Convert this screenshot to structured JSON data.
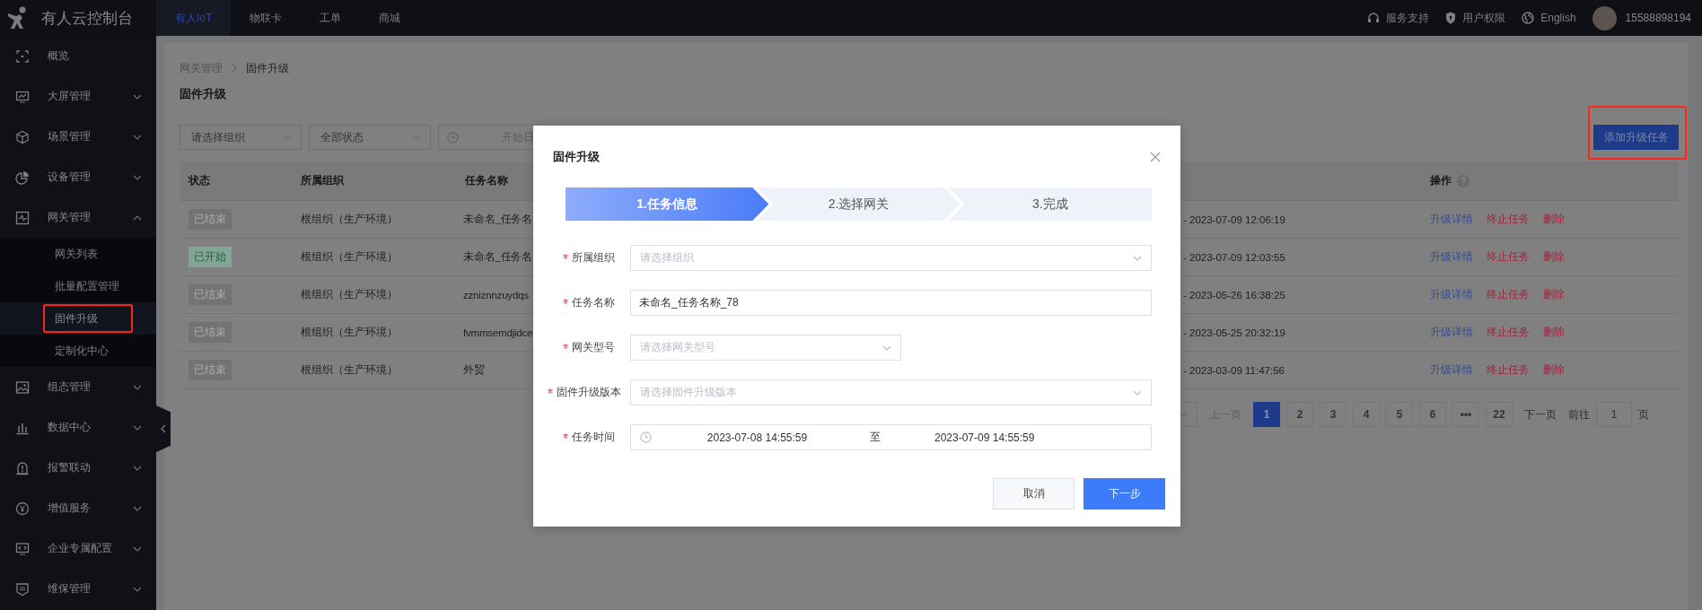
{
  "app": {
    "title": "有人云控制台"
  },
  "top_nav": [
    {
      "label": "有人IoT",
      "selected": true
    },
    {
      "label": "物联卡",
      "selected": false
    },
    {
      "label": "工单",
      "selected": false
    },
    {
      "label": "商城",
      "selected": false
    }
  ],
  "header_links": [
    {
      "kind": "support",
      "label": "服务支持"
    },
    {
      "kind": "permissions",
      "label": "用户权限"
    },
    {
      "kind": "language",
      "label": "English"
    }
  ],
  "user": {
    "phone": "15588898194"
  },
  "sidebar": {
    "items": [
      {
        "kind": "overview",
        "label": "概览"
      },
      {
        "kind": "screen",
        "label": "大屏管理",
        "expanded": false
      },
      {
        "kind": "cube",
        "label": "场景管理",
        "expanded": false
      },
      {
        "kind": "pie",
        "label": "设备管理",
        "expanded": false
      },
      {
        "kind": "pulse",
        "label": "网关管理",
        "expanded": true,
        "children": [
          {
            "label": "网关列表",
            "selected": false,
            "annotated": false
          },
          {
            "label": "批量配置管理",
            "selected": false,
            "annotated": false
          },
          {
            "label": "固件升级",
            "selected": true,
            "annotated": true
          },
          {
            "label": "定制化中心",
            "selected": false,
            "annotated": false
          }
        ]
      },
      {
        "kind": "image",
        "label": "组态管理",
        "expanded": false
      },
      {
        "kind": "bars",
        "label": "数据中心",
        "expanded": false
      },
      {
        "kind": "alarm",
        "label": "报警联动",
        "expanded": false
      },
      {
        "kind": "coin",
        "label": "增值服务",
        "expanded": false
      },
      {
        "kind": "code",
        "label": "企业专属配置",
        "expanded": false
      },
      {
        "kind": "doc",
        "label": "维保管理",
        "expanded": false
      }
    ]
  },
  "breadcrumb": [
    "网关管理",
    "固件升级"
  ],
  "page_title": "固件升级",
  "filters": [
    {
      "kind": "select",
      "placeholder": "请选择组织"
    },
    {
      "kind": "select",
      "value": "全部状态"
    },
    {
      "kind": "date",
      "placeholder": "开始日"
    }
  ],
  "add_button": {
    "label": "添加升级任务",
    "annotated": true
  },
  "table": {
    "columns": [
      {
        "label": "状态",
        "help": false
      },
      {
        "label": "所属组织",
        "help": false
      },
      {
        "label": "任务名称",
        "help": false
      },
      {
        "label": "操作",
        "help": true
      }
    ],
    "rows": [
      {
        "status": {
          "kind": "ended",
          "label": "已结束"
        },
        "organization": "根组织（生产环境）",
        "task_name": "未命名_任务名",
        "column_4": "- 2023-07-09 12:06:19",
        "actions": [
          {
            "kind": "details",
            "label": "升级详情"
          },
          {
            "kind": "stop",
            "label": "终止任务"
          },
          {
            "kind": "delete",
            "label": "删除"
          }
        ]
      },
      {
        "status": {
          "kind": "started",
          "label": "已开始"
        },
        "organization": "根组织（生产环境）",
        "task_name": "未命名_任务名",
        "column_4": "- 2023-07-09 12:03:55",
        "actions": [
          {
            "kind": "details",
            "label": "升级详情"
          },
          {
            "kind": "stop",
            "label": "终止任务"
          },
          {
            "kind": "delete",
            "label": "删除"
          }
        ]
      },
      {
        "status": {
          "kind": "ended",
          "label": "已结束"
        },
        "organization": "根组织（生产环境）",
        "task_name": "zzniznnzuydqs",
        "column_4": "- 2023-05-26 16:38:25",
        "actions": [
          {
            "kind": "details",
            "label": "升级详情"
          },
          {
            "kind": "stop",
            "label": "终止任务"
          },
          {
            "kind": "delete",
            "label": "删除"
          }
        ]
      },
      {
        "status": {
          "kind": "ended",
          "label": "已结束"
        },
        "organization": "根组织（生产环境）",
        "task_name": "fvmmsemdjidce",
        "column_4": "- 2023-05-25 20:32:19",
        "actions": [
          {
            "kind": "details",
            "label": "升级详情"
          },
          {
            "kind": "stop",
            "label": "终止任务"
          },
          {
            "kind": "delete",
            "label": "删除"
          }
        ]
      },
      {
        "status": {
          "kind": "ended",
          "label": "已结束"
        },
        "organization": "根组织（生产环境）",
        "task_name": "外贸",
        "column_4": "- 2023-03-09 11:47:56",
        "actions": [
          {
            "kind": "details",
            "label": "升级详情"
          },
          {
            "kind": "stop",
            "label": "终止任务"
          },
          {
            "kind": "delete",
            "label": "删除"
          }
        ]
      }
    ]
  },
  "pagination": {
    "prev": "上一页",
    "pages": [
      {
        "label": "1",
        "selected": true
      },
      {
        "label": "2",
        "selected": false
      },
      {
        "label": "3",
        "selected": false
      },
      {
        "label": "4",
        "selected": false
      },
      {
        "label": "5",
        "selected": false
      },
      {
        "label": "6",
        "selected": false
      },
      {
        "label": "•••",
        "selected": false
      },
      {
        "label": "22",
        "selected": false
      }
    ],
    "next": "下一页",
    "goto_label": "前往",
    "goto_value": "1",
    "page_suffix": "页"
  },
  "modal": {
    "title": "固件升级",
    "steps": [
      {
        "label": "1.任务信息",
        "selected": true
      },
      {
        "label": "2.选择网关",
        "selected": false
      },
      {
        "label": "3.完成",
        "selected": false
      }
    ],
    "fields": [
      {
        "kind": "select",
        "label": "所属组织",
        "required": true,
        "placeholder": "请选择组织"
      },
      {
        "kind": "text",
        "label": "任务名称",
        "required": true,
        "value": "未命名_任务名称_78"
      },
      {
        "kind": "select",
        "label": "网关型号",
        "required": true,
        "placeholder": "请选择网关型号"
      },
      {
        "kind": "select",
        "label": "固件升级版本",
        "required": true,
        "placeholder": "请选择固件升级版本"
      },
      {
        "kind": "date_range",
        "label": "任务时间",
        "required": true,
        "start": "2023-07-08 14:55:59",
        "separator": "至",
        "end": "2023-07-09 14:55:59"
      }
    ],
    "buttons": [
      {
        "kind": "secondary",
        "label": "取消"
      },
      {
        "kind": "primary",
        "label": "下一步"
      }
    ]
  }
}
